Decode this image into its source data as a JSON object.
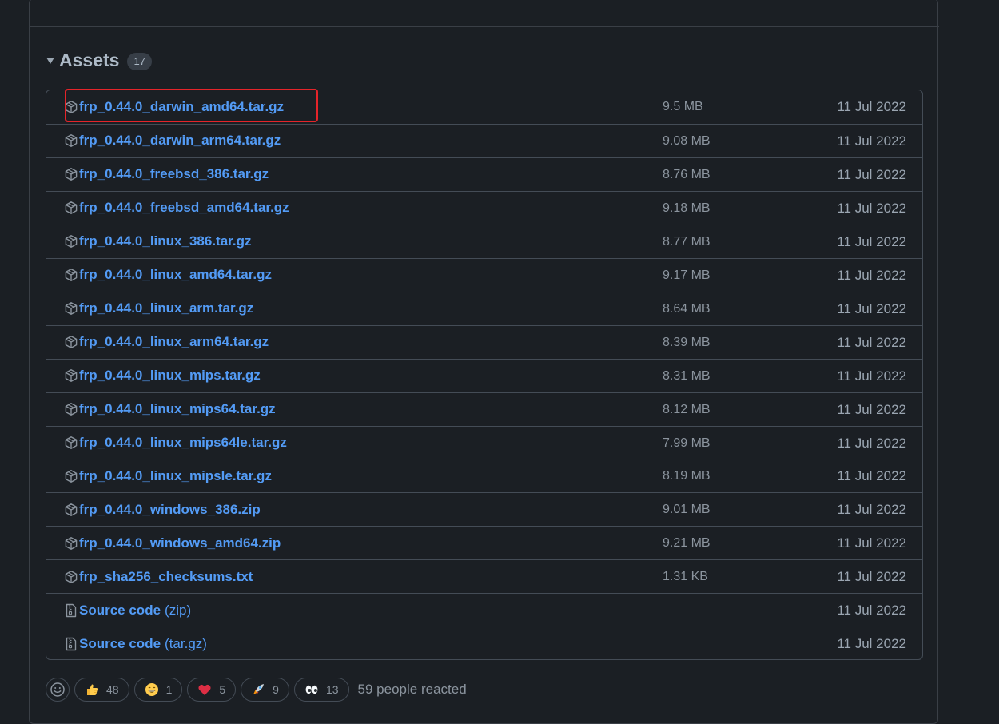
{
  "assets": {
    "title": "Assets",
    "count": "17",
    "items": [
      {
        "name": "frp_0.44.0_darwin_amd64.tar.gz",
        "suffix": "",
        "size": "9.5 MB",
        "date": "11 Jul 2022",
        "icon": "package-icon"
      },
      {
        "name": "frp_0.44.0_darwin_arm64.tar.gz",
        "suffix": "",
        "size": "9.08 MB",
        "date": "11 Jul 2022",
        "icon": "package-icon"
      },
      {
        "name": "frp_0.44.0_freebsd_386.tar.gz",
        "suffix": "",
        "size": "8.76 MB",
        "date": "11 Jul 2022",
        "icon": "package-icon"
      },
      {
        "name": "frp_0.44.0_freebsd_amd64.tar.gz",
        "suffix": "",
        "size": "9.18 MB",
        "date": "11 Jul 2022",
        "icon": "package-icon"
      },
      {
        "name": "frp_0.44.0_linux_386.tar.gz",
        "suffix": "",
        "size": "8.77 MB",
        "date": "11 Jul 2022",
        "icon": "package-icon"
      },
      {
        "name": "frp_0.44.0_linux_amd64.tar.gz",
        "suffix": "",
        "size": "9.17 MB",
        "date": "11 Jul 2022",
        "icon": "package-icon"
      },
      {
        "name": "frp_0.44.0_linux_arm.tar.gz",
        "suffix": "",
        "size": "8.64 MB",
        "date": "11 Jul 2022",
        "icon": "package-icon"
      },
      {
        "name": "frp_0.44.0_linux_arm64.tar.gz",
        "suffix": "",
        "size": "8.39 MB",
        "date": "11 Jul 2022",
        "icon": "package-icon"
      },
      {
        "name": "frp_0.44.0_linux_mips.tar.gz",
        "suffix": "",
        "size": "8.31 MB",
        "date": "11 Jul 2022",
        "icon": "package-icon"
      },
      {
        "name": "frp_0.44.0_linux_mips64.tar.gz",
        "suffix": "",
        "size": "8.12 MB",
        "date": "11 Jul 2022",
        "icon": "package-icon"
      },
      {
        "name": "frp_0.44.0_linux_mips64le.tar.gz",
        "suffix": "",
        "size": "7.99 MB",
        "date": "11 Jul 2022",
        "icon": "package-icon"
      },
      {
        "name": "frp_0.44.0_linux_mipsle.tar.gz",
        "suffix": "",
        "size": "8.19 MB",
        "date": "11 Jul 2022",
        "icon": "package-icon"
      },
      {
        "name": "frp_0.44.0_windows_386.zip",
        "suffix": "",
        "size": "9.01 MB",
        "date": "11 Jul 2022",
        "icon": "package-icon"
      },
      {
        "name": "frp_0.44.0_windows_amd64.zip",
        "suffix": "",
        "size": "9.21 MB",
        "date": "11 Jul 2022",
        "icon": "package-icon"
      },
      {
        "name": "frp_sha256_checksums.txt",
        "suffix": "",
        "size": "1.31 KB",
        "date": "11 Jul 2022",
        "icon": "package-icon"
      },
      {
        "name": "Source code",
        "suffix": "(zip)",
        "size": "",
        "date": "11 Jul 2022",
        "icon": "file-zip-icon"
      },
      {
        "name": "Source code",
        "suffix": "(tar.gz)",
        "size": "",
        "date": "11 Jul 2022",
        "icon": "file-zip-icon"
      }
    ]
  },
  "reactions": {
    "items": [
      {
        "emoji": "thumbs-up",
        "count": "48"
      },
      {
        "emoji": "laugh",
        "count": "1"
      },
      {
        "emoji": "heart",
        "count": "5"
      },
      {
        "emoji": "rocket",
        "count": "9"
      },
      {
        "emoji": "eyes",
        "count": "13"
      }
    ],
    "summary": "59 people reacted"
  },
  "colors": {
    "link": "#539bf5",
    "highlight": "#e5242a",
    "background": "#1b1f24",
    "border": "#444c56"
  }
}
